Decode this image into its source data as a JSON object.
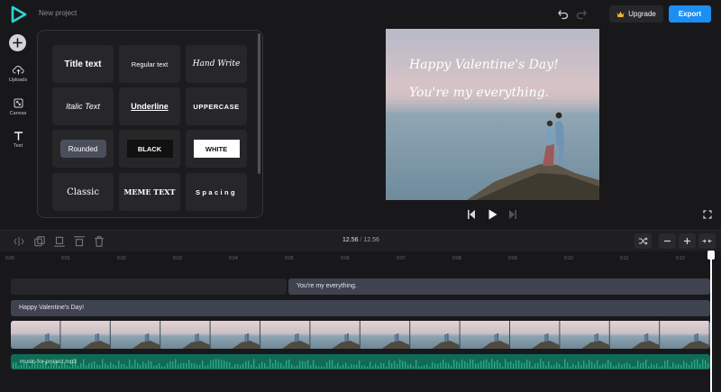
{
  "header": {
    "project_title": "New project",
    "upgrade_label": "Upgrade",
    "export_label": "Export",
    "accent_color": "#1d8ef2"
  },
  "sidebar": {
    "items": [
      {
        "label": "Uploads",
        "icon": "upload-cloud-icon"
      },
      {
        "label": "Canvas",
        "icon": "canvas-icon"
      },
      {
        "label": "Text",
        "icon": "text-icon"
      }
    ]
  },
  "text_presets": [
    {
      "label": "Title text"
    },
    {
      "label": "Regular text"
    },
    {
      "label": "Hand Write"
    },
    {
      "label": "Italic Text"
    },
    {
      "label": "Underline"
    },
    {
      "label": "UPPERCASE"
    },
    {
      "label": "Rounded"
    },
    {
      "label": "BLACK"
    },
    {
      "label": "WHITE"
    },
    {
      "label": "Classic"
    },
    {
      "label": "MEME TEXT"
    },
    {
      "label": "Spacing"
    }
  ],
  "preview": {
    "line1": "Happy Valentine's Day!",
    "line2": "You're my everything."
  },
  "timeline": {
    "current_time": "12.56",
    "separator": "/",
    "total_time": "12.56",
    "ruler": [
      "0:00",
      "0:01",
      "0:02",
      "0:03",
      "0:04",
      "0:05",
      "0:06",
      "0:07",
      "0:08",
      "0:09",
      "0:10",
      "0:11",
      "0:12"
    ],
    "clips": {
      "text2": "You're my everything.",
      "text1": "Happy Valentine's Day!",
      "audio": "music-for-project.mp3"
    }
  }
}
